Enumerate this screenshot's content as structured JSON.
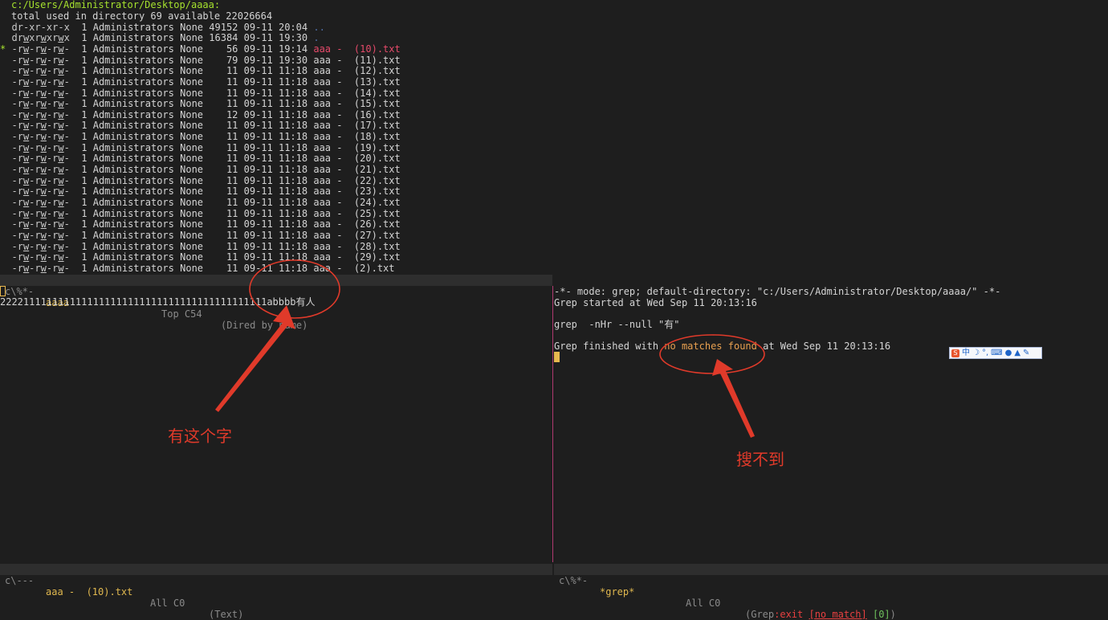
{
  "dired": {
    "header": "c:/Users/Administrator/Desktop/aaaa:",
    "total_line": "total used in directory 69 available 22026664",
    "rows": [
      {
        "mark": " ",
        "perm": "dr-xr-xr-x",
        "links": "1",
        "owner": "Administrators",
        "group": "None",
        "size": "49152",
        "date": "09-11",
        "time": "20:04",
        "name": "..",
        "kind": "dotdir"
      },
      {
        "mark": " ",
        "perm": "drwxrwxrwx",
        "links": "1",
        "owner": "Administrators",
        "group": "None",
        "size": "16384",
        "date": "09-11",
        "time": "19:30",
        "name": ".",
        "kind": "dotdir"
      },
      {
        "mark": "*",
        "perm": "-rw-rw-rw-",
        "links": "1",
        "owner": "Administrators",
        "group": "None",
        "size": "56",
        "date": "09-11",
        "time": "19:14",
        "name": "aaa -  (10).txt",
        "kind": "marked"
      },
      {
        "mark": " ",
        "perm": "-rw-rw-rw-",
        "links": "1",
        "owner": "Administrators",
        "group": "None",
        "size": "79",
        "date": "09-11",
        "time": "19:30",
        "name": "aaa -  (11).txt",
        "kind": "file"
      },
      {
        "mark": " ",
        "perm": "-rw-rw-rw-",
        "links": "1",
        "owner": "Administrators",
        "group": "None",
        "size": "11",
        "date": "09-11",
        "time": "11:18",
        "name": "aaa -  (12).txt",
        "kind": "file"
      },
      {
        "mark": " ",
        "perm": "-rw-rw-rw-",
        "links": "1",
        "owner": "Administrators",
        "group": "None",
        "size": "11",
        "date": "09-11",
        "time": "11:18",
        "name": "aaa -  (13).txt",
        "kind": "file"
      },
      {
        "mark": " ",
        "perm": "-rw-rw-rw-",
        "links": "1",
        "owner": "Administrators",
        "group": "None",
        "size": "11",
        "date": "09-11",
        "time": "11:18",
        "name": "aaa -  (14).txt",
        "kind": "file"
      },
      {
        "mark": " ",
        "perm": "-rw-rw-rw-",
        "links": "1",
        "owner": "Administrators",
        "group": "None",
        "size": "11",
        "date": "09-11",
        "time": "11:18",
        "name": "aaa -  (15).txt",
        "kind": "file"
      },
      {
        "mark": " ",
        "perm": "-rw-rw-rw-",
        "links": "1",
        "owner": "Administrators",
        "group": "None",
        "size": "12",
        "date": "09-11",
        "time": "11:18",
        "name": "aaa -  (16).txt",
        "kind": "file"
      },
      {
        "mark": " ",
        "perm": "-rw-rw-rw-",
        "links": "1",
        "owner": "Administrators",
        "group": "None",
        "size": "11",
        "date": "09-11",
        "time": "11:18",
        "name": "aaa -  (17).txt",
        "kind": "file"
      },
      {
        "mark": " ",
        "perm": "-rw-rw-rw-",
        "links": "1",
        "owner": "Administrators",
        "group": "None",
        "size": "11",
        "date": "09-11",
        "time": "11:18",
        "name": "aaa -  (18).txt",
        "kind": "file"
      },
      {
        "mark": " ",
        "perm": "-rw-rw-rw-",
        "links": "1",
        "owner": "Administrators",
        "group": "None",
        "size": "11",
        "date": "09-11",
        "time": "11:18",
        "name": "aaa -  (19).txt",
        "kind": "file"
      },
      {
        "mark": " ",
        "perm": "-rw-rw-rw-",
        "links": "1",
        "owner": "Administrators",
        "group": "None",
        "size": "11",
        "date": "09-11",
        "time": "11:18",
        "name": "aaa -  (20).txt",
        "kind": "file"
      },
      {
        "mark": " ",
        "perm": "-rw-rw-rw-",
        "links": "1",
        "owner": "Administrators",
        "group": "None",
        "size": "11",
        "date": "09-11",
        "time": "11:18",
        "name": "aaa -  (21).txt",
        "kind": "file"
      },
      {
        "mark": " ",
        "perm": "-rw-rw-rw-",
        "links": "1",
        "owner": "Administrators",
        "group": "None",
        "size": "11",
        "date": "09-11",
        "time": "11:18",
        "name": "aaa -  (22).txt",
        "kind": "file"
      },
      {
        "mark": " ",
        "perm": "-rw-rw-rw-",
        "links": "1",
        "owner": "Administrators",
        "group": "None",
        "size": "11",
        "date": "09-11",
        "time": "11:18",
        "name": "aaa -  (23).txt",
        "kind": "file"
      },
      {
        "mark": " ",
        "perm": "-rw-rw-rw-",
        "links": "1",
        "owner": "Administrators",
        "group": "None",
        "size": "11",
        "date": "09-11",
        "time": "11:18",
        "name": "aaa -  (24).txt",
        "kind": "file"
      },
      {
        "mark": " ",
        "perm": "-rw-rw-rw-",
        "links": "1",
        "owner": "Administrators",
        "group": "None",
        "size": "11",
        "date": "09-11",
        "time": "11:18",
        "name": "aaa -  (25).txt",
        "kind": "file"
      },
      {
        "mark": " ",
        "perm": "-rw-rw-rw-",
        "links": "1",
        "owner": "Administrators",
        "group": "None",
        "size": "11",
        "date": "09-11",
        "time": "11:18",
        "name": "aaa -  (26).txt",
        "kind": "file"
      },
      {
        "mark": " ",
        "perm": "-rw-rw-rw-",
        "links": "1",
        "owner": "Administrators",
        "group": "None",
        "size": "11",
        "date": "09-11",
        "time": "11:18",
        "name": "aaa -  (27).txt",
        "kind": "file"
      },
      {
        "mark": " ",
        "perm": "-rw-rw-rw-",
        "links": "1",
        "owner": "Administrators",
        "group": "None",
        "size": "11",
        "date": "09-11",
        "time": "11:18",
        "name": "aaa -  (28).txt",
        "kind": "file"
      },
      {
        "mark": " ",
        "perm": "-rw-rw-rw-",
        "links": "1",
        "owner": "Administrators",
        "group": "None",
        "size": "11",
        "date": "09-11",
        "time": "11:18",
        "name": "aaa -  (29).txt",
        "kind": "file"
      },
      {
        "mark": " ",
        "perm": "-rw-rw-rw-",
        "links": "1",
        "owner": "Administrators",
        "group": "None",
        "size": "11",
        "date": "09-11",
        "time": "11:18",
        "name": "aaa -  (2).txt",
        "kind": "file"
      }
    ]
  },
  "dired_modeline": {
    "status": "c\\%*-",
    "buffer": "aaaa",
    "position": "Top C54",
    "mode": "(Dired by name)"
  },
  "text_buffer": {
    "cursor_char": "2",
    "content": "2222111111111111111111111111111111111111111111abbbb有人"
  },
  "grep": {
    "header": "-*- mode: grep; default-directory: \"c:/Users/Administrator/Desktop/aaaa/\" -*-",
    "started": "Grep started at Wed Sep 11 20:13:16",
    "command": "grep  -nHr --null \"有\"",
    "finished_prefix": "Grep finished with ",
    "finished_highlight": "no matches found",
    "finished_suffix": " at Wed Sep 11 20:13:16"
  },
  "bottom_left_modeline": {
    "status": "c\\---",
    "buffer": "aaa -  (10).txt",
    "position": "All C0",
    "mode": "(Text)"
  },
  "bottom_right_modeline": {
    "status": "c\\%*-",
    "buffer": "*grep*",
    "position": "All C0",
    "mode_prefix": "(Grep",
    "mode_exit": ":exit",
    "mode_nomatch": "[no match]",
    "mode_code": "[0]",
    "mode_suffix": ")"
  },
  "annotations": {
    "left": "有这个字",
    "right": "搜不到"
  },
  "ime_toolbar": {
    "logo": "S",
    "lang": "中",
    "moon": "☽",
    "punct": "°,",
    "keyboard": "⌨",
    "user": "●",
    "skin": "▲",
    "tools": "✎"
  },
  "colors": {
    "annotation_red": "#e03a2a",
    "dir_green": "#a6e22e",
    "marked_red": "#e64a6a",
    "nomatch_orange": "#e8a050",
    "cursor_yellow": "#e8b84f",
    "divider": "#b03a70"
  }
}
